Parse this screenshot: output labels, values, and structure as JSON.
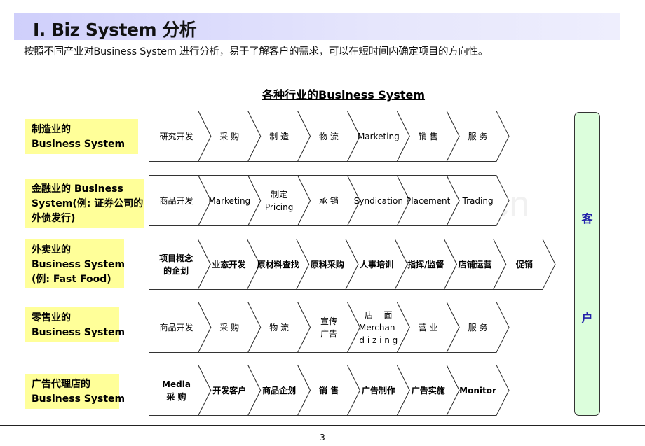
{
  "header": {
    "title": "I. Biz System 分析",
    "subtitle": "按照不同产业对Business System 进行分析，易于了解客户的需求，可以在短时间内确定项目的方向性。"
  },
  "diagram": {
    "title": "各种行业的Business System",
    "customer": {
      "chars": [
        "客",
        "户"
      ]
    },
    "rows": [
      {
        "label": "制造业的\nBusiness System",
        "steps": [
          "研究开发",
          "采 购",
          "制 造",
          "物 流",
          "Marketing",
          "销 售",
          "服 务"
        ]
      },
      {
        "label": "金融业的 Business\nSystem(例: 证券公司的\n外债发行)",
        "steps": [
          "商品开发",
          "Marketing",
          "制定\nPricing",
          "承 销",
          "Syndication",
          "Placement",
          "Trading"
        ]
      },
      {
        "label": "外卖业的\nBusiness System\n(例: Fast Food)",
        "steps": [
          "项目概念\n的企划",
          "业态开发",
          "原材料查找",
          "原料采购",
          "人事培训",
          "指挥/监督",
          "店铺运营",
          "促销"
        ]
      },
      {
        "label": "零售业的\nBusiness System",
        "steps": [
          "商品开发",
          "采 购",
          "物 流",
          "宣传\n广告",
          "店    面\nMerchan-\nd i z i n g",
          "营 业",
          "服 务"
        ]
      },
      {
        "label": "广告代理店的\nBusiness System",
        "steps": [
          "Media\n采 购",
          "开发客户",
          "商品企划",
          "销 售",
          "广告制作",
          "广告实施",
          "Monitor"
        ]
      }
    ]
  },
  "watermark": "www.zixin.com.cn",
  "footer": {
    "page_number": "3"
  }
}
